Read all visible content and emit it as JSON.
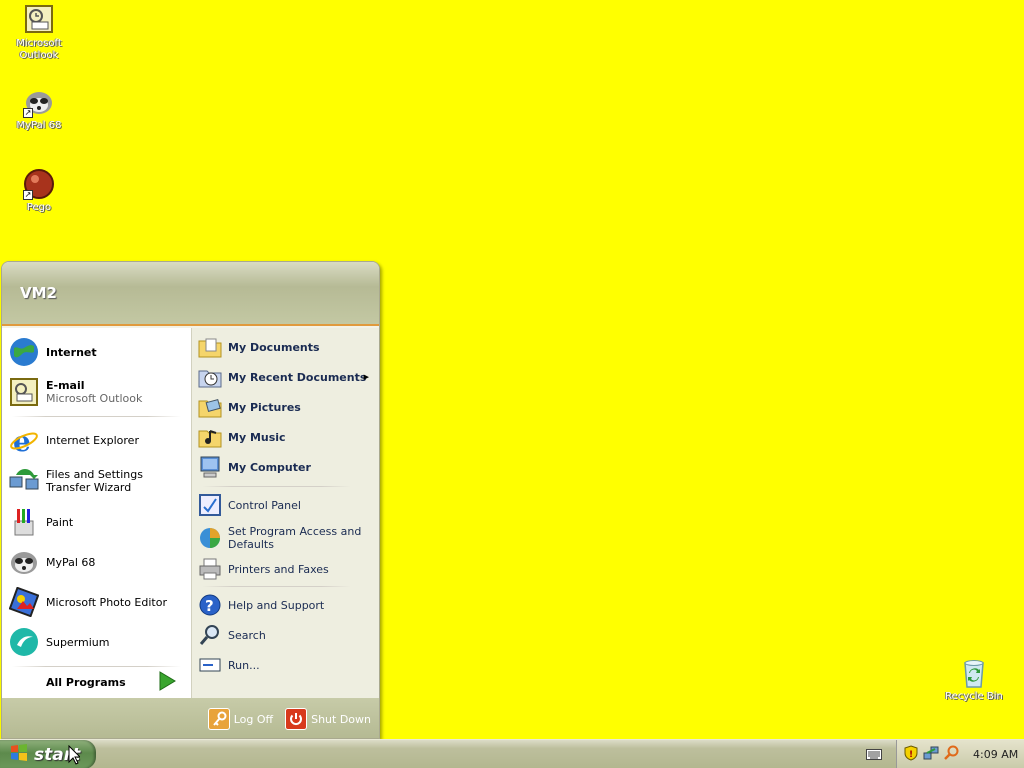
{
  "desktop": {
    "icons": [
      {
        "label": "Microsoft Outlook",
        "icon": "outlook-icon"
      },
      {
        "label": "MyPal 68",
        "icon": "raccoon-icon"
      },
      {
        "label": "Pego",
        "icon": "pego-icon"
      },
      {
        "label": "Recycle Bin",
        "icon": "recycle-bin-icon"
      }
    ]
  },
  "start_menu": {
    "user": "VM2",
    "pinned": [
      {
        "title": "Internet",
        "subtitle": ""
      },
      {
        "title": "E-mail",
        "subtitle": "Microsoft Outlook"
      }
    ],
    "recent": [
      {
        "title": "Internet Explorer"
      },
      {
        "title": "Files and Settings Transfer Wizard"
      },
      {
        "title": "Paint"
      },
      {
        "title": "MyPal 68"
      },
      {
        "title": "Microsoft Photo Editor"
      },
      {
        "title": "Supermium"
      }
    ],
    "all_programs": "All Programs",
    "right": [
      {
        "title": "My Documents"
      },
      {
        "title": "My Recent Documents"
      },
      {
        "title": "My Pictures"
      },
      {
        "title": "My Music"
      },
      {
        "title": "My Computer"
      },
      {
        "title": "Control Panel"
      },
      {
        "title": "Set Program Access and Defaults"
      },
      {
        "title": "Printers and Faxes"
      },
      {
        "title": "Help and Support"
      },
      {
        "title": "Search"
      },
      {
        "title": "Run..."
      }
    ],
    "log_off": "Log Off",
    "shut_down": "Shut Down"
  },
  "taskbar": {
    "start_label": "start",
    "clock": "4:09 AM"
  },
  "colors": {
    "desktop": "#ffff00",
    "accent_orange": "#e09a3d",
    "start_green": "#5d8a4c"
  }
}
